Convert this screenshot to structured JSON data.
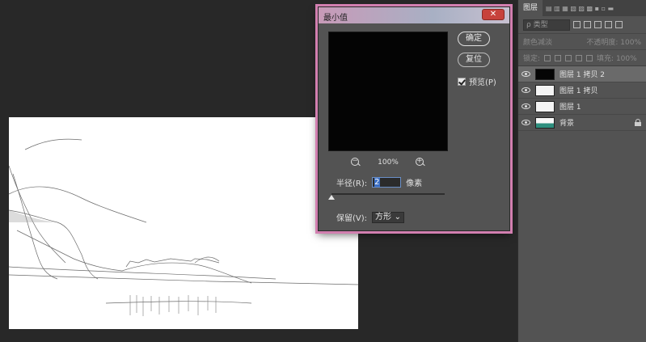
{
  "dialog": {
    "title": "最小值",
    "close_label": "✕",
    "ok_label": "确定",
    "reset_label": "复位",
    "preview_label": "预览(P)",
    "zoom": "100%",
    "zoom_out_label": "−",
    "zoom_in_label": "+",
    "radius_label": "半径(R):",
    "radius_value": "2",
    "radius_unit": "像素",
    "radius_slider_fraction": 0.0,
    "preserve_label": "保留(V):",
    "preserve_value": "方形",
    "preserve_arrow": "⌄"
  },
  "panel": {
    "tab_label": "图层",
    "tab_icons": "▤ ▥ ▦ ▧ ▨ ▩ ▪ ▫ ▬",
    "filter_placeholder": "ρ 类型",
    "blend_mode": "颜色减淡",
    "opacity_label": "不透明度: 100%",
    "lock_label": "锁定:",
    "fill_label": "填充: 100%",
    "layers": [
      {
        "name": "图层 1 拷贝 2",
        "thumb": "black",
        "selected": true
      },
      {
        "name": "图层 1 拷贝",
        "thumb": "white",
        "selected": false
      },
      {
        "name": "图层 1",
        "thumb": "white",
        "selected": false
      },
      {
        "name": "背景",
        "thumb": "bg",
        "selected": false,
        "locked": true
      }
    ]
  },
  "colors": {
    "dialog_border": "#d27fb0",
    "panel_bg": "#535353",
    "workspace_bg": "#282828"
  }
}
